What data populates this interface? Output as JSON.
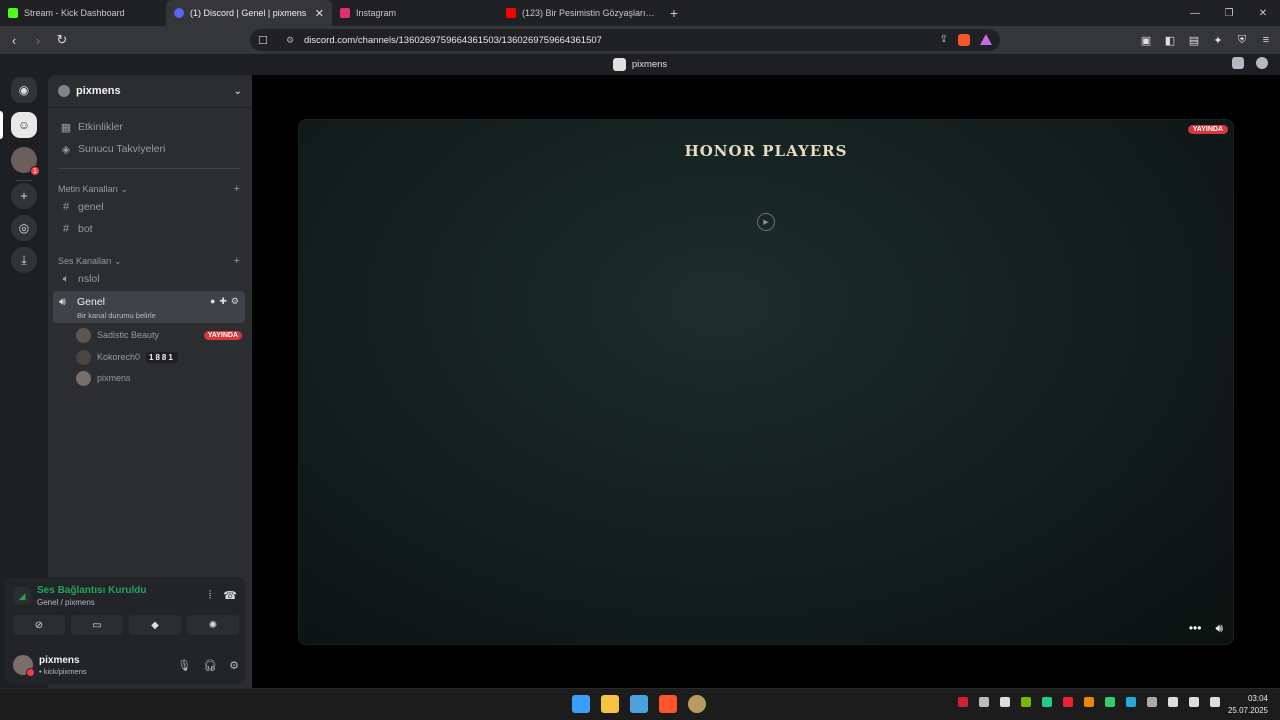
{
  "browser": {
    "tabs": [
      {
        "label": "Stream - Kick Dashboard",
        "color": "#53fc18",
        "active": false
      },
      {
        "label": "(1) Discord | Genel | pixmens",
        "color": "#5865f2",
        "active": true
      },
      {
        "label": "Instagram",
        "color": "#e1306c",
        "active": false
      },
      {
        "label": "(123) Bir Pesimistin Gözyaşları - YouTube",
        "color": "#ff0000",
        "active": false
      }
    ],
    "new_tab": "+",
    "url": "discord.com/channels/1360269759664361503/1360269759664361507"
  },
  "window": {
    "title": "pixmens"
  },
  "rail": {
    "badge_count": "1"
  },
  "server": {
    "name": "pixmens",
    "top_items": [
      {
        "label": "Etkinlikler",
        "icon": "calendar-icon"
      },
      {
        "label": "Sunucu Takviyeleri",
        "icon": "boost-icon"
      }
    ],
    "text_category": "Metin Kanalları",
    "text_channels": [
      "genel",
      "bot"
    ],
    "voice_category": "Ses Kanalları",
    "voice_channels": [
      "nslol"
    ],
    "active_voice": {
      "name": "Genel",
      "status_placeholder": "Bir kanal durumu belirle",
      "users": [
        {
          "name": "Sadistic Beauty",
          "live": "YAYINDA"
        },
        {
          "name": "Kokorech0",
          "tag": "1881"
        },
        {
          "name": "pixmens"
        }
      ]
    }
  },
  "voice_panel": {
    "status": "Ses Bağlantısı Kuruldu",
    "channel": "Genel / pixmens"
  },
  "user_panel": {
    "name": "pixmens",
    "status": "• kick/pixmens"
  },
  "stream": {
    "title": "HONOR PLAYERS",
    "live_label": "YAYINDA"
  },
  "taskbar": {
    "time": "03:04",
    "date": "25.07.2025"
  }
}
